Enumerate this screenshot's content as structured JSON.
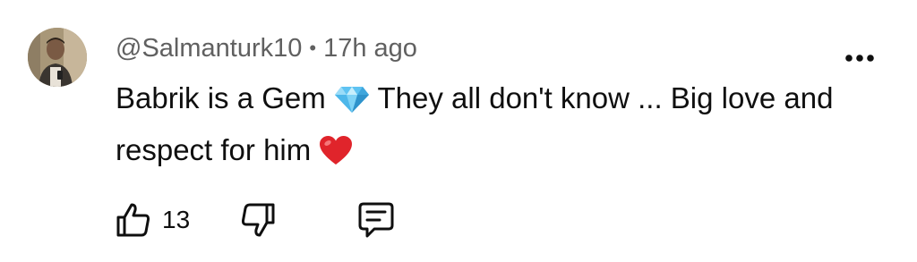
{
  "comment": {
    "author": "@Salmanturk10",
    "separator": "•",
    "time": "17h ago",
    "text_part1": "Babrik is a Gem ",
    "text_part2": " They all don't know ... Big love and respect for him ",
    "likes": "13"
  },
  "icons": {
    "avatar": "user-avatar-photo",
    "menu": "more-vert-icon",
    "gem": "gem-stone-emoji",
    "heart": "red-heart-emoji",
    "like": "thumbs-up-icon",
    "dislike": "thumbs-down-icon",
    "reply": "comment-reply-icon"
  },
  "colors": {
    "meta_text": "#606060",
    "body_text": "#0f0f0f",
    "heart": "#e0242b",
    "gem": "#5ec3f2"
  }
}
